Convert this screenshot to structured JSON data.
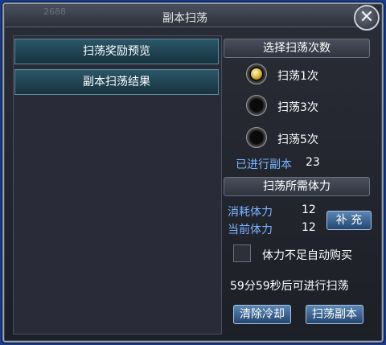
{
  "dialog": {
    "title": "副本扫荡",
    "bg_number": "2688",
    "close_glyph": "✕"
  },
  "left": {
    "tab_rewards": "扫荡奖励预览",
    "tab_results": "副本扫荡结果"
  },
  "right": {
    "select_count_header": "选择扫荡次数",
    "options": [
      {
        "label": "扫荡1次",
        "selected": true
      },
      {
        "label": "扫荡3次",
        "selected": false
      },
      {
        "label": "扫荡5次",
        "selected": false
      }
    ],
    "done_label": "已进行副本",
    "done_value": "23",
    "stamina_header": "扫荡所需体力",
    "consume_label": "消耗体力",
    "consume_value": "12",
    "current_label": "当前体力",
    "current_value": "12",
    "refill_button": "补 充",
    "auto_buy_label": "体力不足自动购买",
    "auto_buy_checked": false,
    "cooldown_text": "59分59秒后可进行扫荡",
    "clear_cd_button": "清除冷却",
    "sweep_button": "扫荡副本"
  },
  "colors": {
    "accent_blue": "#7ab4ff",
    "tab_bg": "#2b5768",
    "button_bg": "#3f6a97",
    "outer_bg": "#1b3a8c"
  }
}
